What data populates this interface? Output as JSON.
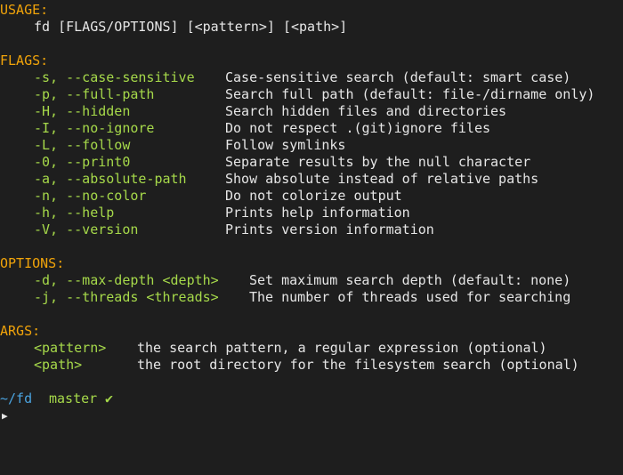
{
  "usage": {
    "header": "USAGE:",
    "line": "fd [FLAGS/OPTIONS] [<pattern>] [<path>]"
  },
  "flags": {
    "header": "FLAGS:",
    "items": [
      {
        "flag": "-s, --case-sensitive",
        "desc": "Case-sensitive search (default: smart case)"
      },
      {
        "flag": "-p, --full-path",
        "desc": "Search full path (default: file-/dirname only)"
      },
      {
        "flag": "-H, --hidden",
        "desc": "Search hidden files and directories"
      },
      {
        "flag": "-I, --no-ignore",
        "desc": "Do not respect .(git)ignore files"
      },
      {
        "flag": "-L, --follow",
        "desc": "Follow symlinks"
      },
      {
        "flag": "-0, --print0",
        "desc": "Separate results by the null character"
      },
      {
        "flag": "-a, --absolute-path",
        "desc": "Show absolute instead of relative paths"
      },
      {
        "flag": "-n, --no-color",
        "desc": "Do not colorize output"
      },
      {
        "flag": "-h, --help",
        "desc": "Prints help information"
      },
      {
        "flag": "-V, --version",
        "desc": "Prints version information"
      }
    ]
  },
  "options": {
    "header": "OPTIONS:",
    "items": [
      {
        "flag": "-d, --max-depth <depth>",
        "desc": "Set maximum search depth (default: none)"
      },
      {
        "flag": "-j, --threads <threads>",
        "desc": "The number of threads used for searching"
      }
    ]
  },
  "args": {
    "header": "ARGS:",
    "items": [
      {
        "flag": "<pattern>",
        "desc": "the search pattern, a regular expression (optional)"
      },
      {
        "flag": "<path>",
        "desc": "the root directory for the filesystem search (optional)"
      }
    ]
  },
  "prompt": {
    "cwd": "~/fd",
    "branch": "master",
    "status_glyph": "✔",
    "cursor_glyph": "▶"
  },
  "colors": {
    "background": "#1e1e1e",
    "header": "#f0a30a",
    "flag": "#a6d94a",
    "text": "#e6e6e6",
    "path": "#4aa3df"
  }
}
